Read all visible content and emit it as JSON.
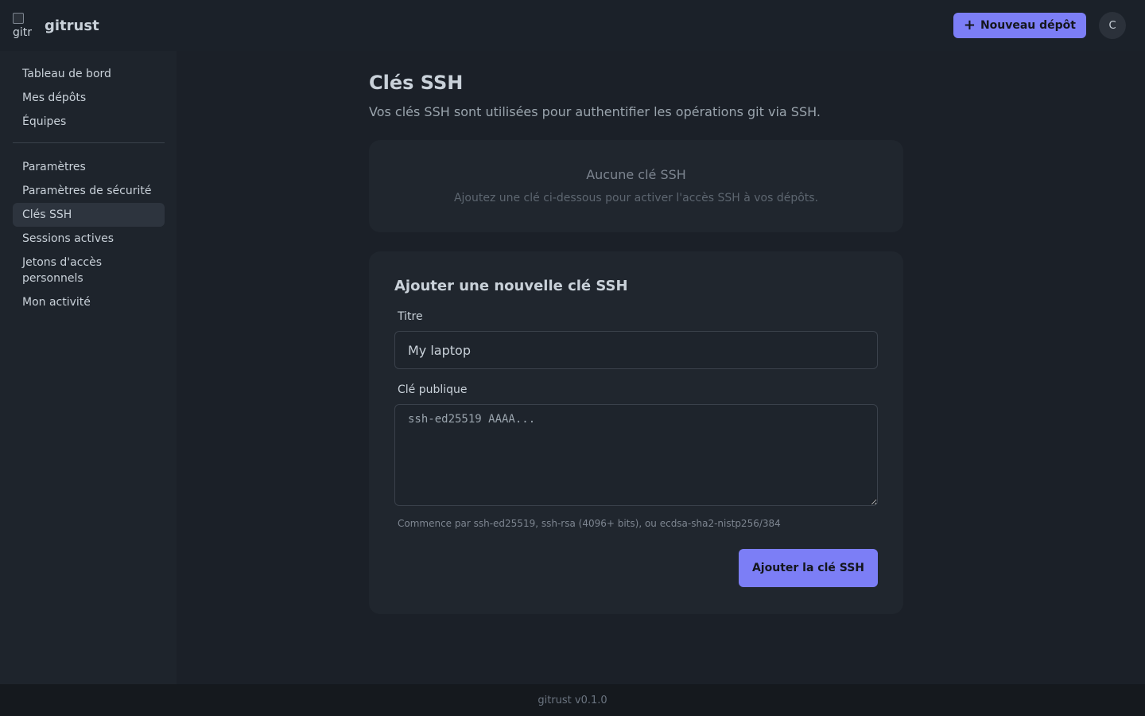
{
  "header": {
    "logo_alt": "gitr",
    "brand": "gitrust",
    "new_repo_label": "Nouveau dépôt",
    "avatar_initial": "C"
  },
  "sidebar": {
    "group1": [
      {
        "label": "Tableau de bord"
      },
      {
        "label": "Mes dépôts"
      },
      {
        "label": "Équipes"
      }
    ],
    "group2": [
      {
        "label": "Paramètres"
      },
      {
        "label": "Paramètres de sécurité"
      },
      {
        "label": "Clés SSH",
        "active": true
      },
      {
        "label": "Sessions actives"
      },
      {
        "label": "Jetons d'accès personnels"
      },
      {
        "label": "Mon activité"
      }
    ]
  },
  "main": {
    "title": "Clés SSH",
    "subtitle": "Vos clés SSH sont utilisées pour authentifier les opérations git via SSH.",
    "empty": {
      "title": "Aucune clé SSH",
      "description": "Ajoutez une clé ci-dessous pour activer l'accès SSH à vos dépôts."
    },
    "form": {
      "title": "Ajouter une nouvelle clé SSH",
      "title_label": "Titre",
      "title_placeholder": "My laptop",
      "key_label": "Clé publique",
      "key_placeholder": "ssh-ed25519 AAAA...",
      "hint": "Commence par ssh-ed25519, ssh-rsa (4096+ bits), ou ecdsa-sha2-nistp256/384",
      "submit_label": "Ajouter la clé SSH"
    }
  },
  "footer": {
    "version": "gitrust v0.1.0"
  },
  "colors": {
    "accent": "#7c7ef6",
    "background": "#1b2028",
    "sidebar": "#1e242c",
    "card": "#20262e"
  }
}
